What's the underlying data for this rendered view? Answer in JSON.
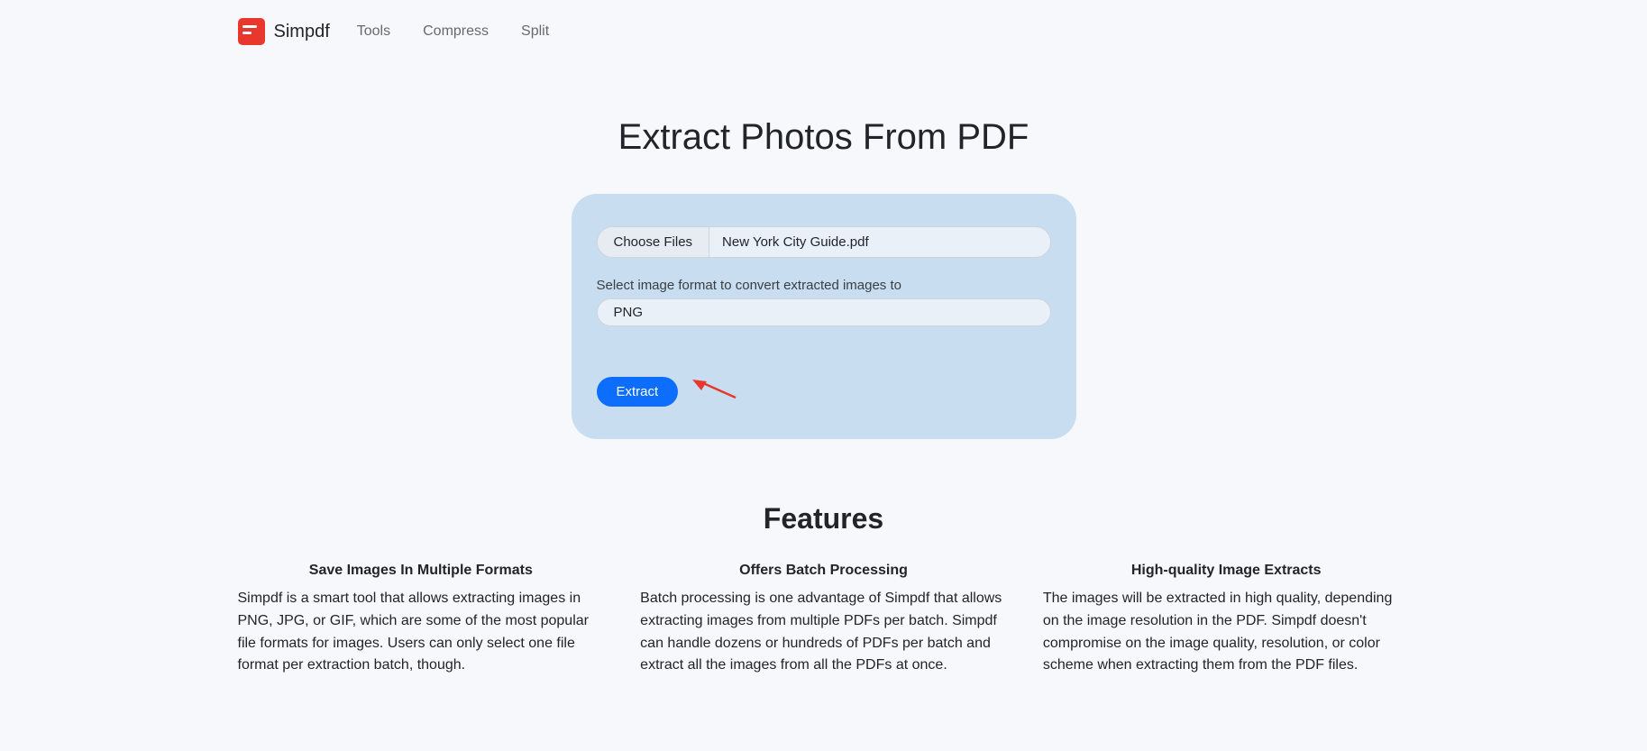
{
  "nav": {
    "brand": "Simpdf",
    "links": [
      "Tools",
      "Compress",
      "Split"
    ]
  },
  "page": {
    "title": "Extract Photos From PDF"
  },
  "form": {
    "choose_label": "Choose Files",
    "file_name": "New York City Guide.pdf",
    "format_label": "Select image format to convert extracted images to",
    "format_value": "PNG",
    "extract_label": "Extract"
  },
  "features": {
    "title": "Features",
    "items": [
      {
        "heading": "Save Images In Multiple Formats",
        "text": "Simpdf is a smart tool that allows extracting images in PNG, JPG, or GIF, which are some of the most popular file formats for images. Users can only select one file format per extraction batch, though."
      },
      {
        "heading": "Offers Batch Processing",
        "text": "Batch processing is one advantage of Simpdf that allows extracting images from multiple PDFs per batch. Simpdf can handle dozens or hundreds of PDFs per batch and extract all the images from all the PDFs at once."
      },
      {
        "heading": "High-quality Image Extracts",
        "text": "The images will be extracted in high quality, depending on the image resolution in the PDF. Simpdf doesn't compromise on the image quality, resolution, or color scheme when extracting them from the PDF files."
      }
    ]
  }
}
